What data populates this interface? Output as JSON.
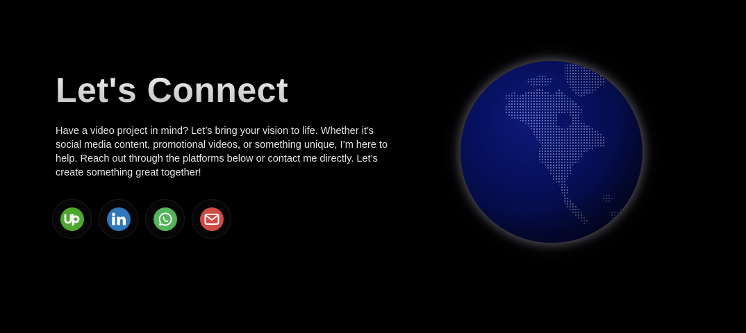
{
  "contact": {
    "title": "Let's Connect",
    "description": "Have a video project in mind? Let’s bring your vision to life. Whether it’s social media content, promotional videos, or something unique, I’m here to help. Reach out through the platforms below or contact me directly. Let’s create something great together!"
  },
  "socials": [
    {
      "name": "upwork",
      "icon": "upwork-icon",
      "color": "#4ea72e",
      "glyph": "up"
    },
    {
      "name": "linkedin",
      "icon": "linkedin-icon",
      "color": "#2f76bb",
      "glyph": "in"
    },
    {
      "name": "whatsapp",
      "icon": "whatsapp-icon",
      "color": "#54b45a"
    },
    {
      "name": "email",
      "icon": "mail-icon",
      "color": "#cf4b45"
    }
  ],
  "globe": {
    "icon": "globe-icon",
    "ocean_color": "#081268",
    "land_dot_color": "#aeb6e6"
  }
}
